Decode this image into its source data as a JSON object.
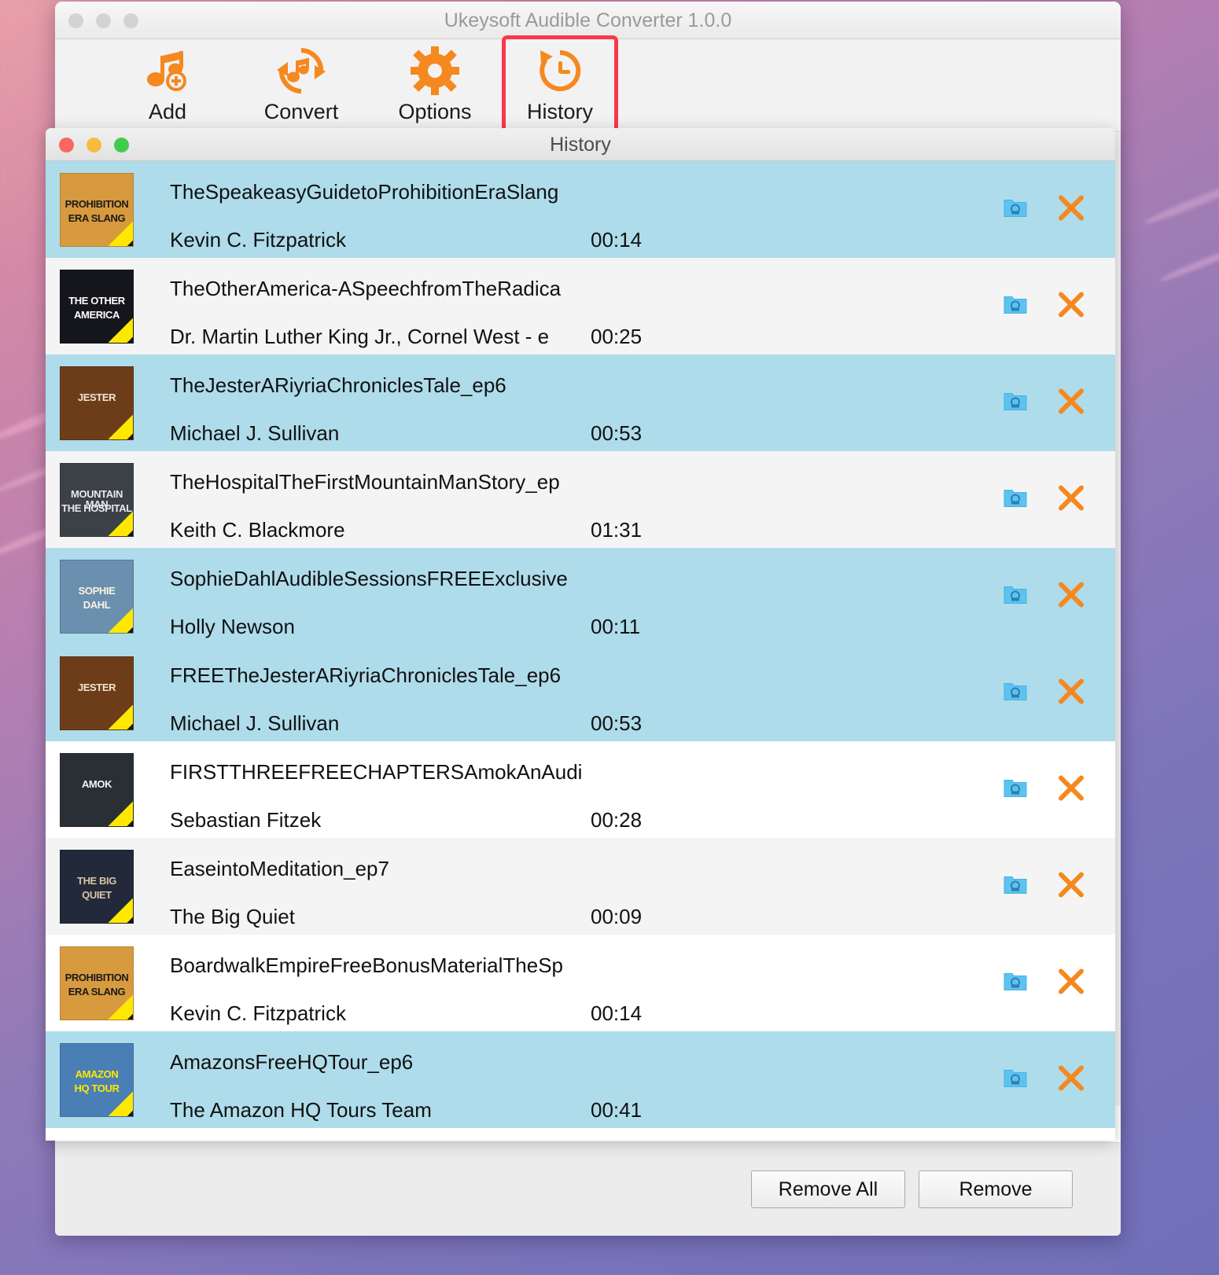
{
  "app": {
    "title": "Ukeysoft Audible Converter 1.0.0",
    "toolbar": [
      {
        "label": "Add",
        "icon": "music-note-add-icon"
      },
      {
        "label": "Convert",
        "icon": "convert-refresh-icon"
      },
      {
        "label": "Options",
        "icon": "gear-icon"
      },
      {
        "label": "History",
        "icon": "history-clock-icon",
        "highlighted": true
      }
    ]
  },
  "history_window": {
    "title": "History",
    "rows": [
      {
        "title": "TheSpeakeasyGuidetoProhibitionEraSlang",
        "author": "Kevin C. Fitzpatrick",
        "duration": "00:14",
        "selected": true,
        "cover": {
          "line1": "PROHIBITION",
          "line2": "ERA SLANG",
          "bg": "#d89a3e",
          "fg": "#1a1a1a"
        }
      },
      {
        "title": "TheOtherAmerica-ASpeechfromTheRadica",
        "author": "Dr. Martin Luther King Jr., Cornel West - e",
        "duration": "00:25",
        "selected": false,
        "cover": {
          "line1": "THE OTHER",
          "line2": "AMERICA",
          "bg": "#15151c",
          "fg": "#ffffff"
        }
      },
      {
        "title": "TheJesterARiyriaChroniclesTale_ep6",
        "author": "Michael J. Sullivan",
        "duration": "00:53",
        "selected": true,
        "cover": {
          "line1": "JESTER",
          "line2": "",
          "bg": "#6d3d19",
          "fg": "#f0e4d2"
        }
      },
      {
        "title": "TheHospitalTheFirstMountainManStory_ep",
        "author": "Keith C. Blackmore",
        "duration": "01:31",
        "selected": false,
        "cover": {
          "line1": "MOUNTAIN MAN",
          "line2": "THE HOSPITAL",
          "bg": "#3c4148",
          "fg": "#e8e8e8"
        }
      },
      {
        "title": "SophieDahlAudibleSessionsFREEExclusive",
        "author": "Holly Newson",
        "duration": "00:11",
        "selected": true,
        "cover": {
          "line1": "SOPHIE",
          "line2": "DAHL",
          "bg": "#6b8fae",
          "fg": "#fdf4e2"
        }
      },
      {
        "title": "FREETheJesterARiyriaChroniclesTale_ep6",
        "author": "Michael J. Sullivan",
        "duration": "00:53",
        "selected": true,
        "cover": {
          "line1": "JESTER",
          "line2": "",
          "bg": "#6d3d19",
          "fg": "#f0e4d2"
        }
      },
      {
        "title": "FIRSTTHREEFREECHAPTERSAmokAnAudi",
        "author": "Sebastian Fitzek",
        "duration": "00:28",
        "selected": false,
        "cover": {
          "line1": "AMOK",
          "line2": "",
          "bg": "#2a2f36",
          "fg": "#f4f4f4"
        }
      },
      {
        "title": "EaseintoMeditation_ep7",
        "author": "The Big Quiet",
        "duration": "00:09",
        "selected": false,
        "cover": {
          "line1": "THE BIG",
          "line2": "QUIET",
          "bg": "#21293a",
          "fg": "#d9c4a0"
        }
      },
      {
        "title": "BoardwalkEmpireFreeBonusMaterialTheSp",
        "author": "Kevin C. Fitzpatrick",
        "duration": "00:14",
        "selected": false,
        "cover": {
          "line1": "PROHIBITION",
          "line2": "ERA SLANG",
          "bg": "#d89a3e",
          "fg": "#1a1a1a"
        }
      },
      {
        "title": "AmazonsFreeHQTour_ep6",
        "author": "The Amazon HQ Tours Team",
        "duration": "00:41",
        "selected": true,
        "cover": {
          "line1": "AMAZON",
          "line2": "HQ TOUR",
          "bg": "#4a7fb5",
          "fg": "#ffe800"
        }
      }
    ],
    "row_action_icons": {
      "open_folder": "folder-icon",
      "remove_row": "close-x-icon"
    }
  },
  "footer": {
    "remove_all_label": "Remove All",
    "remove_label": "Remove"
  },
  "colors": {
    "accent_orange": "#f5881f",
    "selection_blue": "#aedcea",
    "highlight_red": "#f9384a",
    "folder_blue": "#4ab8ef"
  }
}
